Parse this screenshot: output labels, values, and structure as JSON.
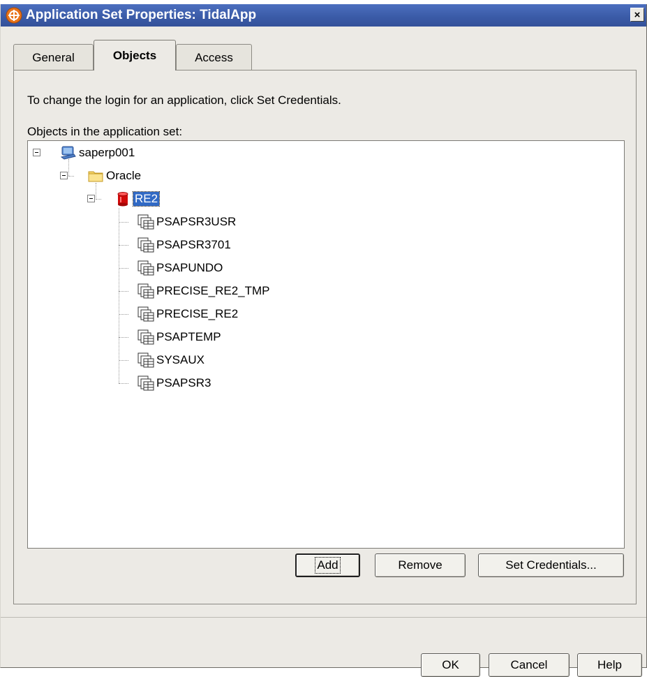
{
  "window": {
    "title": "Application Set Properties: TidalApp",
    "close_label": "×"
  },
  "tabs": [
    {
      "label": "General"
    },
    {
      "label": "Objects"
    },
    {
      "label": "Access"
    }
  ],
  "objects_tab": {
    "instruction": "To change the login for an application, click Set Credentials.",
    "list_label": "Objects in the application set:",
    "tree": {
      "server": "saperp001",
      "folder": "Oracle",
      "instance": "RE2",
      "items": [
        "PSAPSR3USR",
        "PSAPSR3701",
        "PSAPUNDO",
        "PRECISE_RE2_TMP",
        "PRECISE_RE2",
        "PSAPTEMP",
        "SYSAUX",
        "PSAPSR3"
      ]
    },
    "buttons": {
      "add": "Add",
      "remove": "Remove",
      "set_credentials": "Set Credentials..."
    }
  },
  "footer": {
    "ok": "OK",
    "cancel": "Cancel",
    "help": "Help"
  },
  "icons": {
    "app": "application-set-icon",
    "server": "server-computer-icon",
    "folder": "folder-icon",
    "instance": "database-cylinder-icon",
    "tablespace": "tablespace-icon"
  },
  "colors": {
    "titlebar": "#3a5aa6",
    "selection": "#316ac5",
    "dialog_bg": "#eceae5",
    "db_red": "#d10a0a",
    "folder_yellow": "#f5d469"
  }
}
